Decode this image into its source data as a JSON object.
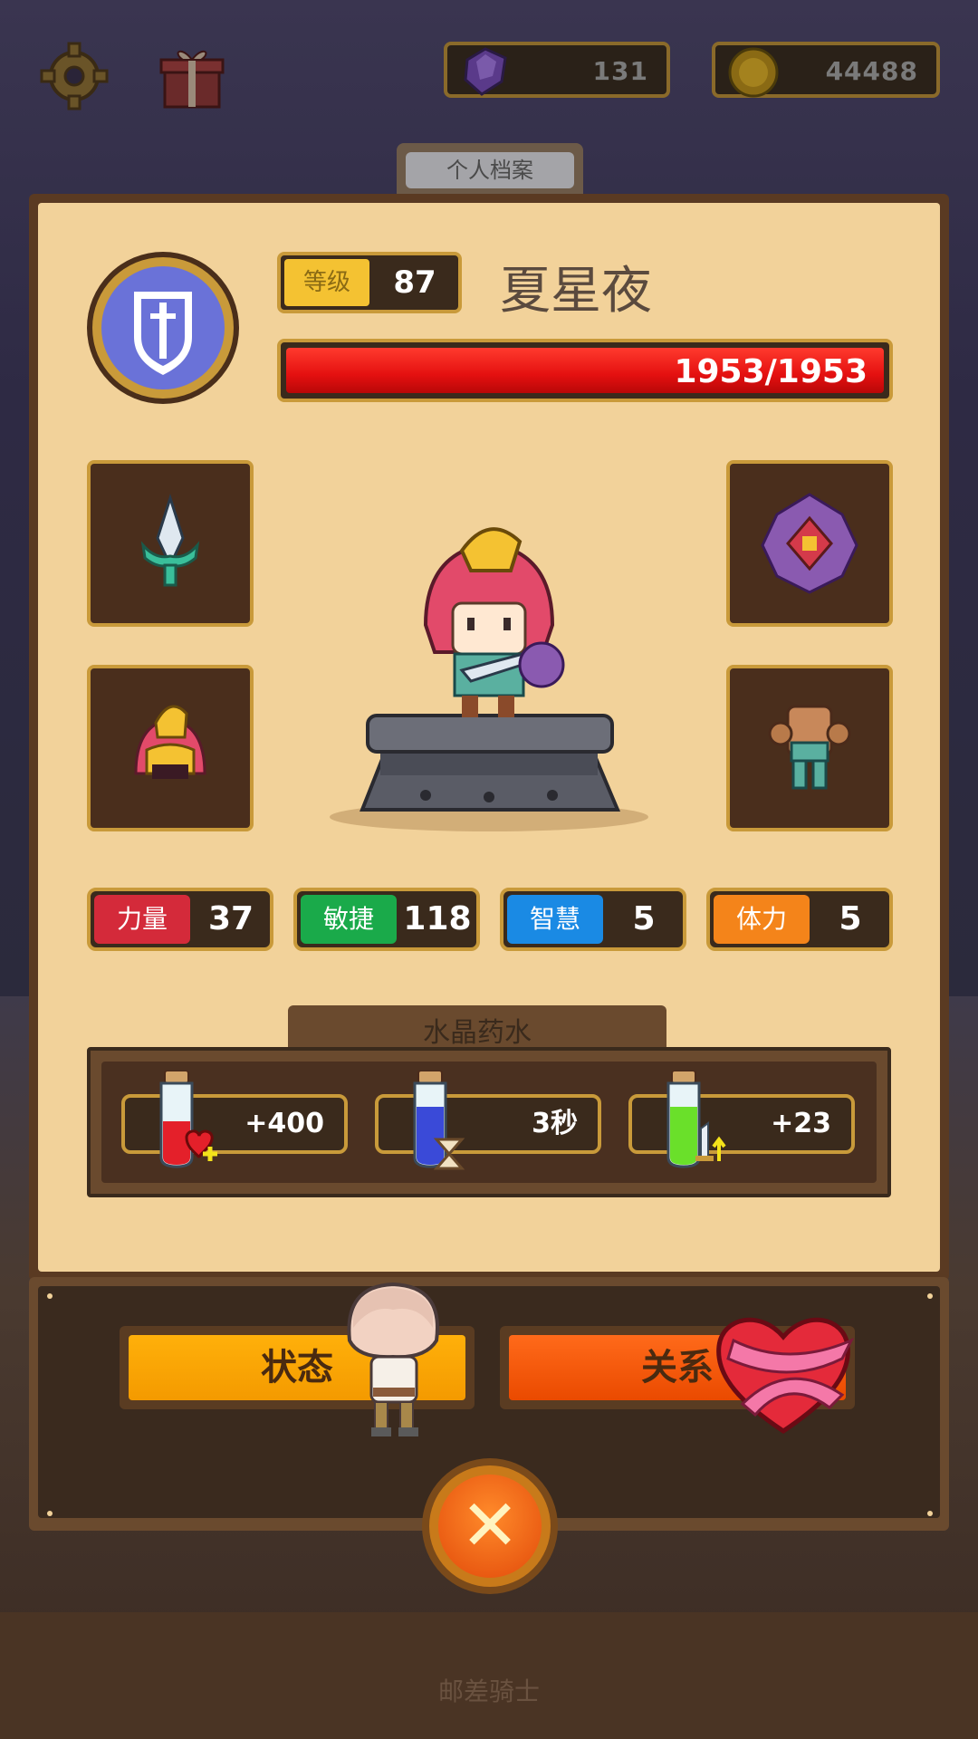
{
  "top_bar": {
    "gems": "131",
    "coins": "44488"
  },
  "tab": {
    "title": "个人档案"
  },
  "profile": {
    "level_label": "等级",
    "level": "87",
    "name": "夏星夜",
    "hp_text": "1953/1953",
    "hp_fraction": 1.0
  },
  "equipment": {
    "weapon_icon": "dagger-icon",
    "shield_icon": "shield-icon",
    "helmet_icon": "helmet-icon",
    "armor_icon": "armor-icon"
  },
  "stats": [
    {
      "label": "力量",
      "value": "37",
      "color": "#d42a3a"
    },
    {
      "label": "敏捷",
      "value": "118",
      "color": "#1aaa4a"
    },
    {
      "label": "智慧",
      "value": "5",
      "color": "#1a8ae4"
    },
    {
      "label": "体力",
      "value": "5",
      "color": "#f4841a"
    }
  ],
  "potions": {
    "title": "水晶药水",
    "items": [
      {
        "value": "+400",
        "icon": "red-potion-heart-icon"
      },
      {
        "value": "3秒",
        "icon": "blue-potion-hourglass-icon"
      },
      {
        "value": "+23",
        "icon": "green-potion-sword-icon"
      }
    ]
  },
  "buttons": {
    "status": "状态",
    "relation": "关系"
  },
  "footer": {
    "text": "邮差骑士"
  },
  "colors": {
    "panel_bg": "#f2d29a",
    "frame_gold": "#c99a3a",
    "hp_red": "#e41010"
  }
}
